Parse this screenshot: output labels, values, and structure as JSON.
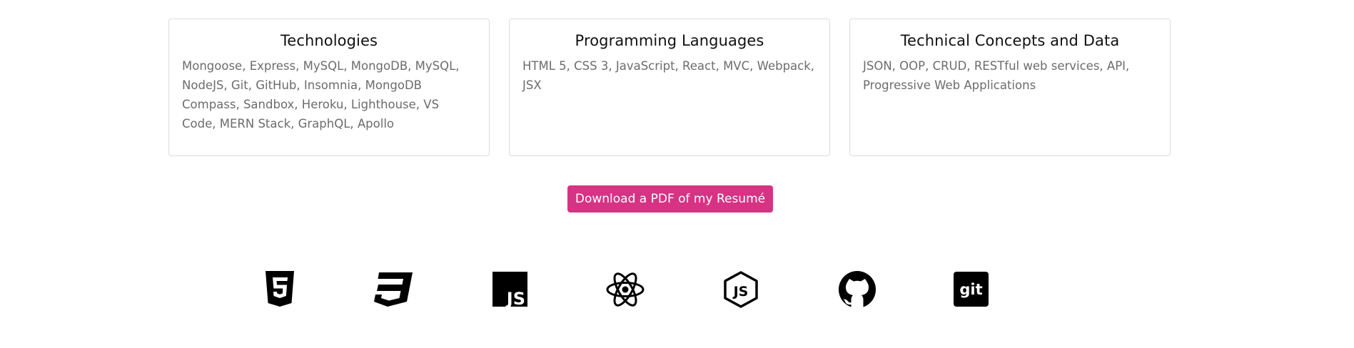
{
  "cards": [
    {
      "title": "Technologies",
      "text": "Mongoose, Express, MySQL, MongoDB, MySQL, NodeJS, Git, GitHub, Insomnia, MongoDB Compass, Sandbox, Heroku, Lighthouse, VS Code, MERN Stack, GraphQL, Apollo"
    },
    {
      "title": "Programming Languages",
      "text": "HTML 5, CSS 3, JavaScript, React, MVC, Webpack, JSX"
    },
    {
      "title": "Technical Concepts and Data",
      "text": "JSON, OOP, CRUD, RESTful web services, API, Progressive Web Applications"
    }
  ],
  "download": {
    "label": "Download a PDF of my Resumé",
    "color": "#d63384"
  },
  "tech_icons": [
    {
      "name": "html5-icon"
    },
    {
      "name": "css3-icon"
    },
    {
      "name": "javascript-icon",
      "label": "JS"
    },
    {
      "name": "react-icon"
    },
    {
      "name": "nodejs-icon",
      "label": "JS"
    },
    {
      "name": "github-icon"
    },
    {
      "name": "git-icon",
      "label": "git"
    }
  ]
}
